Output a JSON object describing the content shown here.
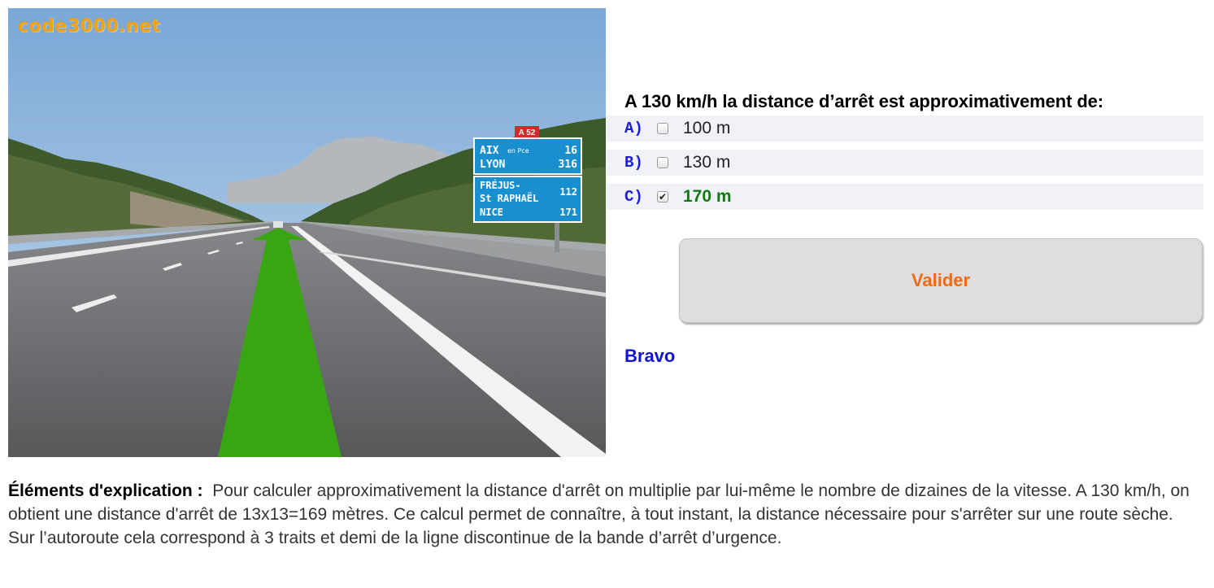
{
  "image": {
    "watermark": "code3000.net",
    "sign_motorway": "A 52",
    "sign_top": [
      {
        "place": "AIX",
        "suffix": "en Pce",
        "distance": "16"
      },
      {
        "place": "LYON",
        "suffix": "",
        "distance": "316"
      }
    ],
    "sign_bottom": [
      {
        "place": "FRÉJUS-",
        "distance": ""
      },
      {
        "place": "St RAPHAËL",
        "distance": "112"
      },
      {
        "place": "NICE",
        "distance": "171"
      }
    ]
  },
  "quiz": {
    "question": "A 130 km/h la distance d’arrêt est approximativement de:",
    "options": [
      {
        "letter": "A)",
        "text": "100 m",
        "checked": false,
        "correct": false
      },
      {
        "letter": "B)",
        "text": "130 m",
        "checked": false,
        "correct": false
      },
      {
        "letter": "C)",
        "text": "170 m",
        "checked": true,
        "correct": true
      }
    ],
    "validate_label": "Valider",
    "result": "Bravo"
  },
  "explanation": {
    "label": "Éléments d'explication :",
    "text": "Pour calculer approximativement la distance d'arrêt on multiplie par lui-même le nombre de dizaines de la vitesse. A 130 km/h, on obtient une distance d'arrêt de 13x13=169 mètres. Ce calcul permet de connaître, à tout instant, la distance nécessaire pour s'arrêter sur une route sèche. Sur l’autoroute cela correspond à 3 traits et demi de la ligne discontinue de la bande d’arrêt d’urgence."
  },
  "colors": {
    "arrow": "#3aa512",
    "sign_blue": "#1a8fd0",
    "watermark": "#f2a20a",
    "validate_text": "#ee6a14",
    "result": "#1212d6",
    "correct_answer": "#127a12",
    "option_letter": "#1d1dde"
  },
  "icons": [
    "green-direction-arrow",
    "checkbox-icon"
  ]
}
